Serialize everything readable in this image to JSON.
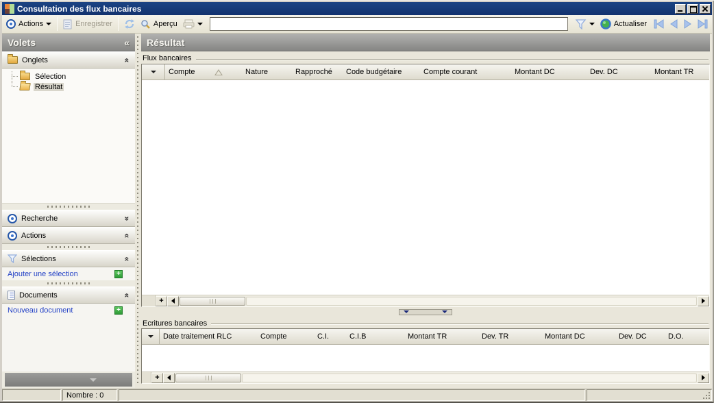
{
  "window": {
    "title": "Consultation des flux bancaires"
  },
  "toolbar": {
    "actions_label": "Actions",
    "save_label": "Enregistrer",
    "preview_label": "Aperçu",
    "refresh_label": "Actualiser",
    "filter_value": ""
  },
  "sidebar": {
    "title": "Volets",
    "onglets": {
      "label": "Onglets"
    },
    "tree": {
      "items": [
        {
          "label": "Sélection"
        },
        {
          "label": "Résultat"
        }
      ]
    },
    "recherche": {
      "label": "Recherche"
    },
    "actions": {
      "label": "Actions"
    },
    "selections": {
      "label": "Sélections",
      "link": "Ajouter une sélection"
    },
    "documents": {
      "label": "Documents",
      "link": "Nouveau document"
    }
  },
  "main": {
    "title": "Résultat",
    "flux": {
      "label": "Flux bancaires",
      "columns": [
        "Compte",
        "Nature",
        "Rapproché",
        "Code budgétaire",
        "Compte courant",
        "Montant DC",
        "Dev. DC",
        "Montant TR"
      ]
    },
    "ecritures": {
      "label": "Ecritures bancaires",
      "columns": [
        "Date traitement RLC",
        "Compte",
        "C.I.",
        "C.I.B",
        "Montant TR",
        "Dev. TR",
        "Montant DC",
        "Dev. DC",
        "D.O."
      ]
    }
  },
  "statusbar": {
    "count": "Nombre : 0"
  },
  "colors": {
    "titlebar": "#12326e",
    "link": "#2442c6",
    "add_button": "#3aad42",
    "header_gray": "#8e8e8c"
  }
}
